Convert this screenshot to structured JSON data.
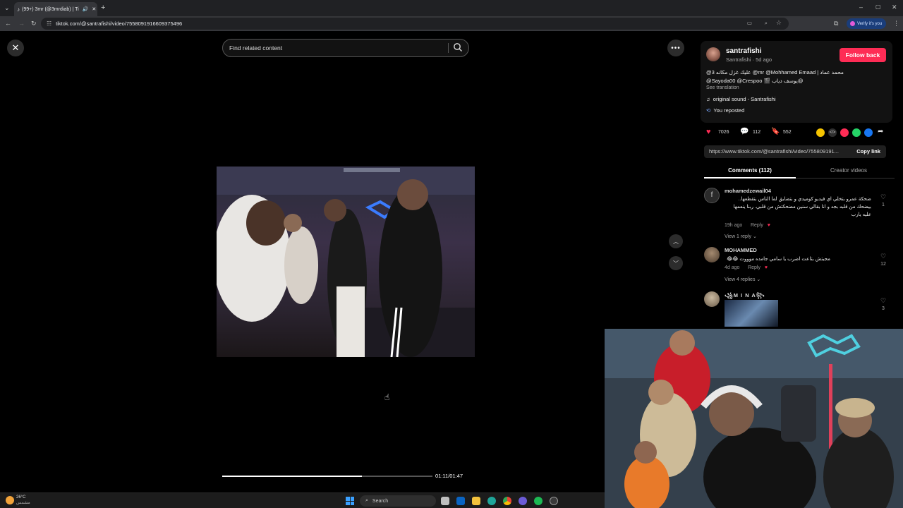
{
  "browser": {
    "tab_title": "(99+) 3mr (@3mrdiab) | Ti",
    "url": "tiktok.com/@santrafishi/video/7558091916609375496",
    "profile_label": "Verify it's you"
  },
  "player": {
    "search_placeholder": "Find related content",
    "time": "01:11/01:47",
    "progress": 0.663
  },
  "post": {
    "username": "santrafishi",
    "subline": "Santrafishi · 5d ago",
    "follow_label": "Follow back",
    "caption_line1": "محمد عماد | mr @Mohhamed Emaad@ عليك غزل مكانه 3@",
    "caption_line2": "@Sayoda00 @Crespoo 🎬 يوسف دياب@",
    "see_translation": "See translation",
    "sound": "original sound - Santrafishi",
    "reposted": "You reposted"
  },
  "stats": {
    "likes": "7026",
    "comments": "112",
    "saves": "552"
  },
  "share": {
    "link": "https://www.tiktok.com/@santrafishi/video/755809191...",
    "copy_label": "Copy link"
  },
  "tabs": {
    "comments": "Comments (112)",
    "creator": "Creator videos"
  },
  "comments": [
    {
      "name": "mohamedzewail04",
      "text": "ضحكة عمرو بتخلي اي فيديو كوميدي و بتضايق لما الناس بتقطعها.. بيضحك من قلبه بجد و انا بقالي سنين مضحكتش من قلبي. ربنا ينعمها عليه يارب",
      "time": "19h ago",
      "reply": "Reply",
      "likes": "1",
      "replies": "View 1 reply"
    },
    {
      "name": "MOHAMMED",
      "text": "مجبتش بتاعت اضرب يا سامي جامده موووت 😂😂",
      "time": "4d ago",
      "reply": "Reply",
      "likes": "12",
      "replies": "View 4 replies"
    },
    {
      "name": "꧁M I N A꧂",
      "likes": "3"
    }
  ],
  "taskbar": {
    "temperature": "26°C",
    "weather": "مشمس",
    "search_label": "Search"
  }
}
